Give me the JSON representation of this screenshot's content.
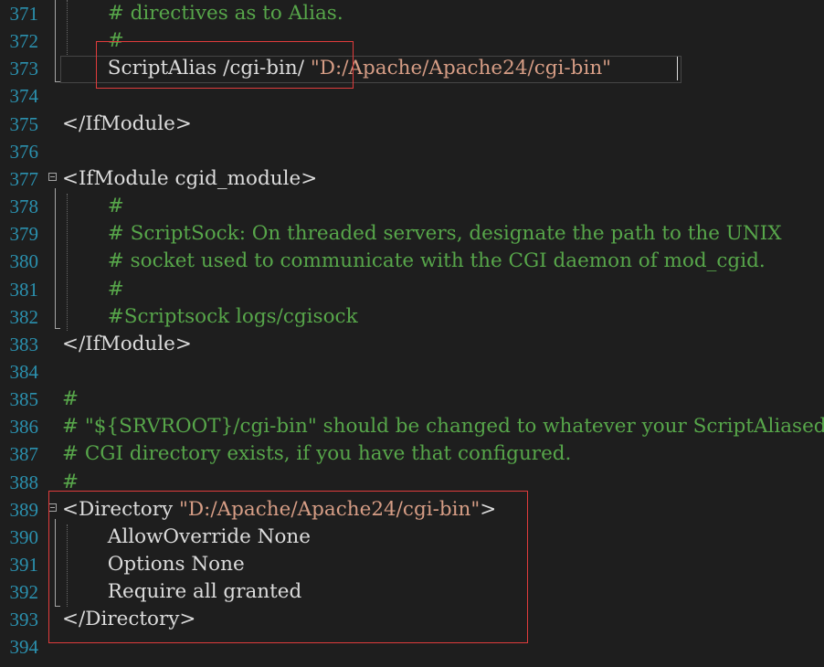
{
  "editor": {
    "colors": {
      "background": "#1e1e1e",
      "line_number": "#2b91af",
      "comment": "#57a64a",
      "text": "#dcdcdc",
      "string": "#d69d85",
      "highlight_box": "#e03c3c"
    },
    "lines": [
      {
        "num": "371",
        "indent": "    ",
        "parts": [
          {
            "t": "# directives as to Alias.",
            "k": "comment"
          }
        ]
      },
      {
        "num": "372",
        "indent": "    ",
        "parts": [
          {
            "t": "#",
            "k": "comment"
          }
        ]
      },
      {
        "num": "373",
        "indent": "    ",
        "parts": [
          {
            "t": "ScriptAlias /cgi-bin/ ",
            "k": "text"
          },
          {
            "t": "\"D:/Apache/Apache24/cgi-bin\"",
            "k": "string"
          }
        ]
      },
      {
        "num": "374",
        "indent": "",
        "parts": []
      },
      {
        "num": "375",
        "indent": "",
        "parts": [
          {
            "t": "</IfModule>",
            "k": "tag"
          }
        ]
      },
      {
        "num": "376",
        "indent": "",
        "parts": []
      },
      {
        "num": "377",
        "indent": "",
        "parts": [
          {
            "t": "<IfModule cgid_module>",
            "k": "tag"
          }
        ]
      },
      {
        "num": "378",
        "indent": "    ",
        "parts": [
          {
            "t": "#",
            "k": "comment"
          }
        ]
      },
      {
        "num": "379",
        "indent": "    ",
        "parts": [
          {
            "t": "# ScriptSock: On threaded servers, designate the path to the UNIX",
            "k": "comment"
          }
        ]
      },
      {
        "num": "380",
        "indent": "    ",
        "parts": [
          {
            "t": "# socket used to communicate with the CGI daemon of mod_cgid.",
            "k": "comment"
          }
        ]
      },
      {
        "num": "381",
        "indent": "    ",
        "parts": [
          {
            "t": "#",
            "k": "comment"
          }
        ]
      },
      {
        "num": "382",
        "indent": "    ",
        "parts": [
          {
            "t": "#Scriptsock logs/cgisock",
            "k": "comment"
          }
        ]
      },
      {
        "num": "383",
        "indent": "",
        "parts": [
          {
            "t": "</IfModule>",
            "k": "tag"
          }
        ]
      },
      {
        "num": "384",
        "indent": "",
        "parts": []
      },
      {
        "num": "385",
        "indent": "",
        "parts": [
          {
            "t": "#",
            "k": "comment"
          }
        ]
      },
      {
        "num": "386",
        "indent": "",
        "parts": [
          {
            "t": "# \"${SRVROOT}/cgi-bin\" should be changed to whatever your ScriptAliased",
            "k": "comment"
          }
        ]
      },
      {
        "num": "387",
        "indent": "",
        "parts": [
          {
            "t": "# CGI directory exists, if you have that configured.",
            "k": "comment"
          }
        ]
      },
      {
        "num": "388",
        "indent": "",
        "parts": [
          {
            "t": "#",
            "k": "comment"
          }
        ]
      },
      {
        "num": "389",
        "indent": "",
        "parts": [
          {
            "t": "<Directory ",
            "k": "tag"
          },
          {
            "t": "\"D:/Apache/Apache24/cgi-bin\"",
            "k": "string"
          },
          {
            "t": ">",
            "k": "tag"
          }
        ]
      },
      {
        "num": "390",
        "indent": "    ",
        "parts": [
          {
            "t": "AllowOverride None",
            "k": "text"
          }
        ]
      },
      {
        "num": "391",
        "indent": "    ",
        "parts": [
          {
            "t": "Options None",
            "k": "text"
          }
        ]
      },
      {
        "num": "392",
        "indent": "    ",
        "parts": [
          {
            "t": "Require all granted",
            "k": "text"
          }
        ]
      },
      {
        "num": "393",
        "indent": "",
        "parts": [
          {
            "t": "</Directory>",
            "k": "tag"
          }
        ]
      },
      {
        "num": "394",
        "indent": "",
        "parts": []
      }
    ]
  }
}
